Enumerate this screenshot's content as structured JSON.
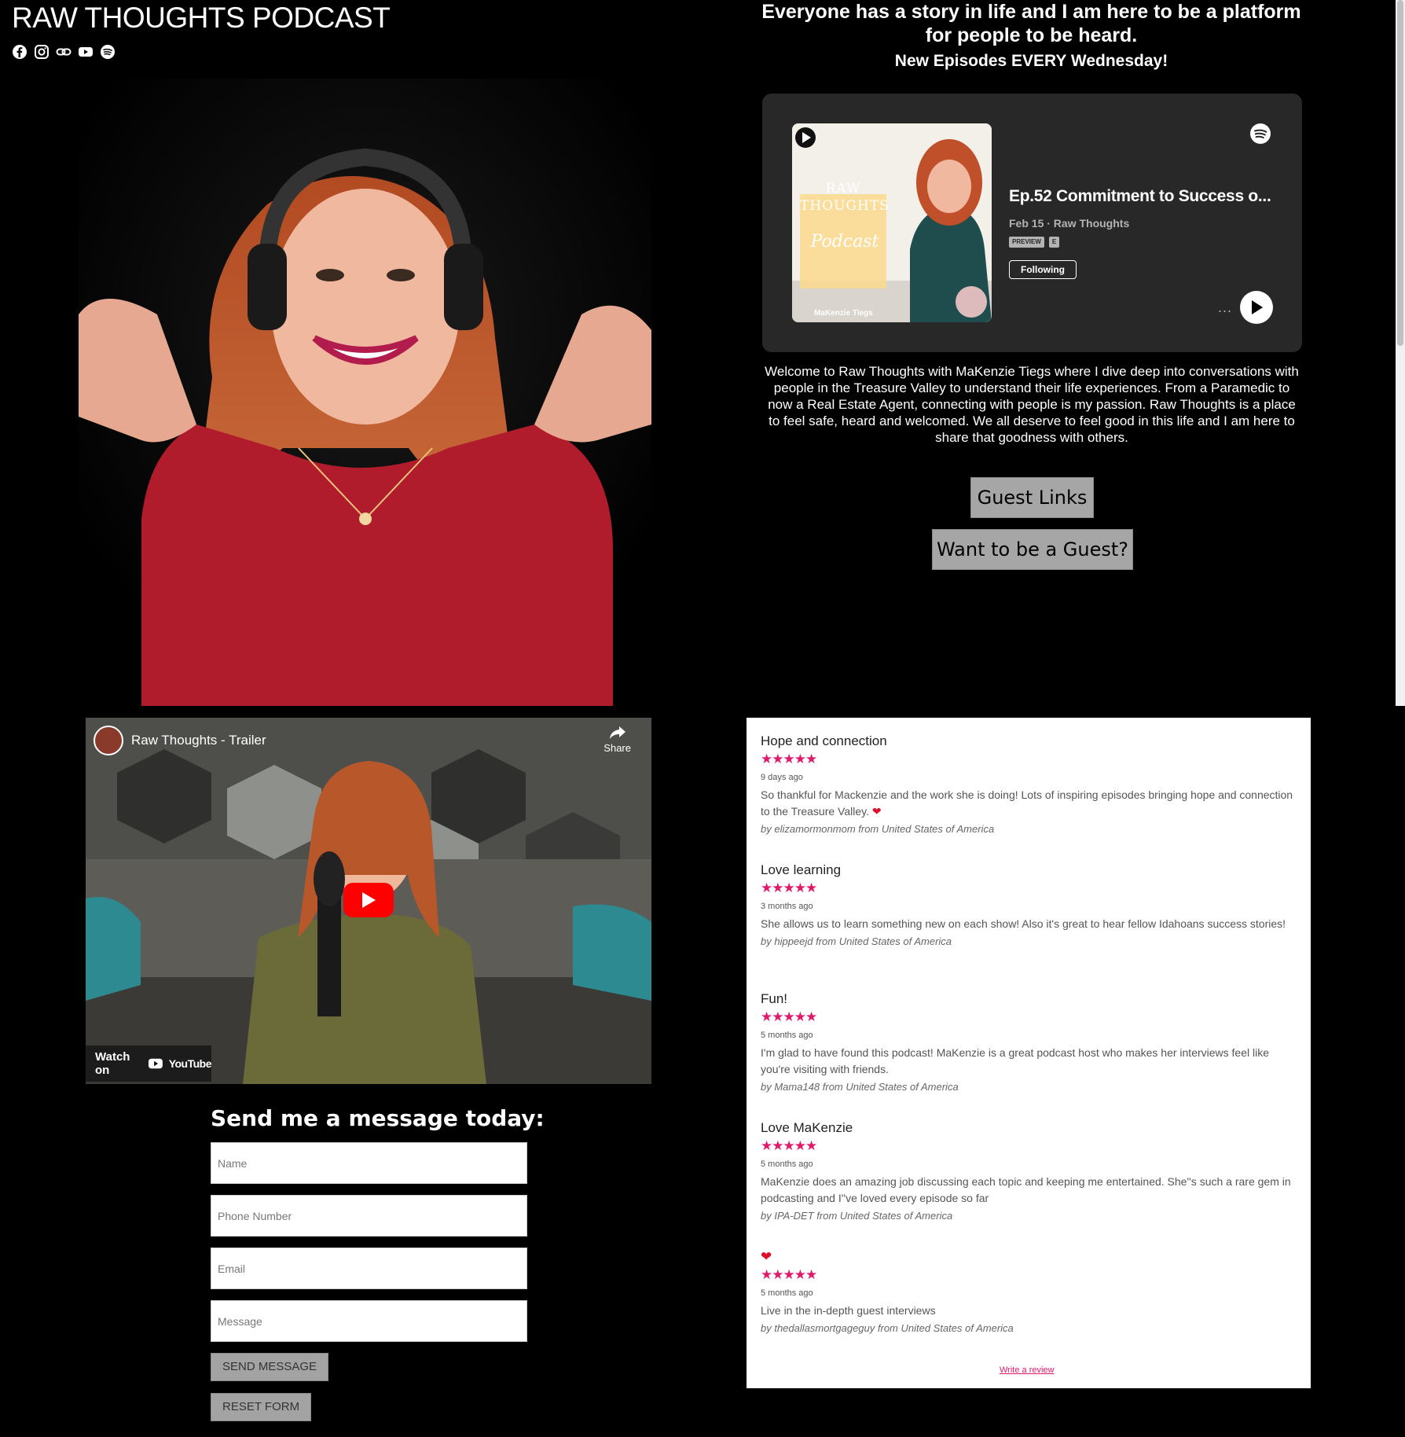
{
  "header": {
    "site_title": "RAW THOUGHTS PODCAST",
    "social_icons": [
      "facebook-icon",
      "instagram-icon",
      "link-icon",
      "youtube-icon",
      "spotify-icon"
    ]
  },
  "hero": {
    "tagline": "Everyone has a story in life and I am here to be a platform for people to be heard.",
    "subline": "New Episodes EVERY Wednesday!"
  },
  "spotify_embed": {
    "cover_brand": "RAW THOUGHTS",
    "cover_script": "Podcast",
    "cover_host": "MaKenzie Tiegs",
    "episode_title": "Ep.52 Commitment to Success o...",
    "meta": "Feb 15 · Raw Thoughts",
    "badge_preview": "PREVIEW",
    "badge_explicit": "E",
    "following_label": "Following",
    "more": "...",
    "colors": {
      "card_bg": "#282828",
      "spotify_green": "#1db954"
    }
  },
  "welcome_text": "Welcome to Raw Thoughts with MaKenzie Tiegs where I dive deep into conversations with people in the Treasure Valley to understand their life experiences. From a Paramedic to now a Real Estate Agent, connecting with people is my passion. Raw Thoughts is a place to feel safe, heard and welcomed. We all deserve to feel good in this life and I am here to share that goodness with others.",
  "buttons": {
    "guest_links": "Guest Links",
    "want_guest": "Want to be a Guest?"
  },
  "video": {
    "title": "Raw Thoughts - Trailer",
    "share_label": "Share",
    "watch_on": "Watch on",
    "youtube_label": "YouTube"
  },
  "form": {
    "heading": "Send me a message today:",
    "name_placeholder": "Name",
    "phone_placeholder": "Phone Number",
    "email_placeholder": "Email",
    "message_placeholder": "Message",
    "send_label": "SEND MESSAGE",
    "reset_label": "RESET FORM"
  },
  "reviews": {
    "items": [
      {
        "title": "Hope and connection",
        "rating": 5,
        "date": "9 days ago",
        "body": "So thankful for Mackenzie and the work she is doing! Lots of inspiring episodes bringing hope and connection to the Treasure Valley.",
        "by": "by elizamormonmom from United States of America"
      },
      {
        "title": "Love learning",
        "rating": 5,
        "date": "3 months ago",
        "body": "She allows us to learn something new on each show! Also it's great to hear fellow Idahoans success stories!",
        "by": "by hippeejd from United States of America"
      },
      {
        "title": "Fun!",
        "rating": 5,
        "date": "5 months ago",
        "body": "I'm glad to have found this podcast! MaKenzie is a great podcast host who makes her interviews feel like you're visiting with friends.",
        "by": "by Mama148 from United States of America"
      },
      {
        "title": "Love MaKenzie",
        "rating": 5,
        "date": "5 months ago",
        "body": "MaKenzie does an amazing job discussing each topic and keeping me entertained. She''s such a rare gem in podcasting and I''ve loved every episode so far",
        "by": "by IPA-DET from United States of America"
      },
      {
        "title": "❤",
        "rating": 5,
        "date": "5 months ago",
        "body": "Live in the in-depth guest interviews",
        "by": "by thedallasmortgageguy from United States of America"
      }
    ],
    "write_review": "Write a review",
    "star_color": "#e0196b"
  }
}
